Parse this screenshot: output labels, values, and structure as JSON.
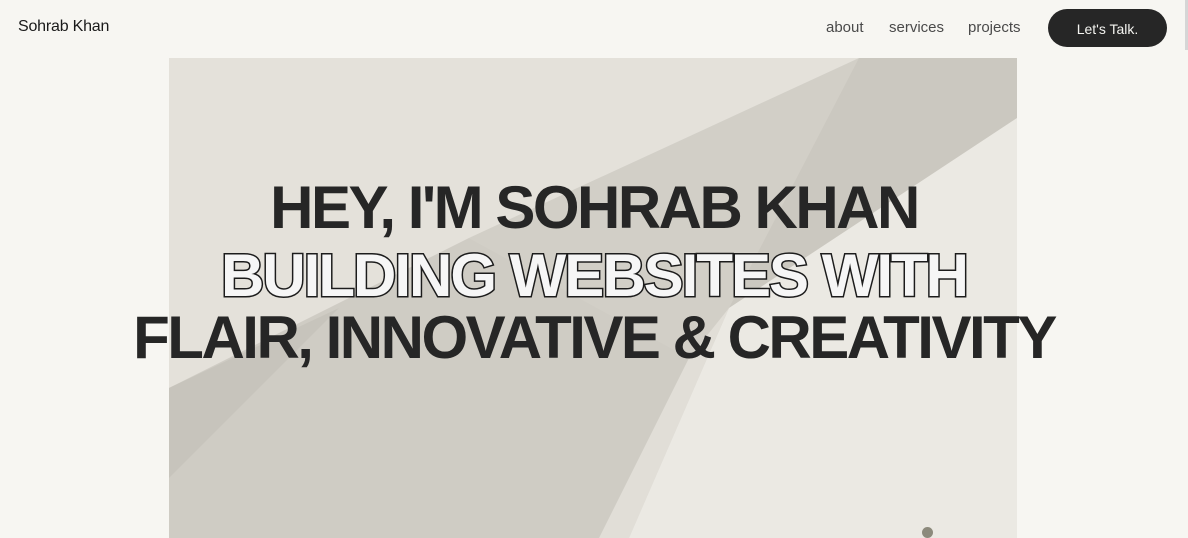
{
  "nav": {
    "brand": "Sohrab Khan",
    "links": [
      "about",
      "services",
      "projects"
    ],
    "cta_label": "Let's Talk."
  },
  "hero": {
    "line_1": "HEY, I'M SOHRAB KHAN",
    "line_2": "BUILDING WEBSITES WITH",
    "line_3": "FLAIR, INNOVATIVE & CREATIVITY"
  },
  "colors": {
    "background": "#f7f6f2",
    "text_dark": "#262626",
    "button_bg": "#262626",
    "button_text": "#f4f4f0",
    "hero_image_tone": "#dedbd4",
    "indicator_dot": "#8c8a7c"
  }
}
